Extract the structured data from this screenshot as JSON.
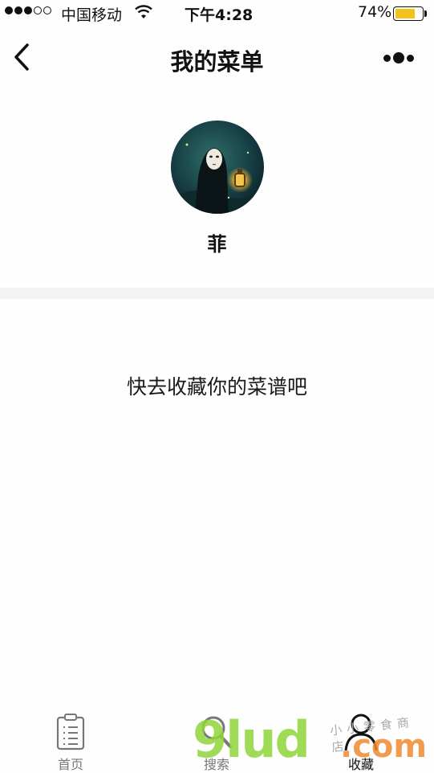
{
  "status_bar": {
    "carrier": "中国移动",
    "time": "下午4:28",
    "battery_percent": "74%",
    "battery_level": 0.74,
    "battery_color": "#f2c31a"
  },
  "nav": {
    "title": "我的菜单"
  },
  "profile": {
    "name": "菲"
  },
  "empty_state": {
    "message": "快去收藏你的菜谱吧"
  },
  "tab_bar": {
    "items": [
      {
        "label": "首页",
        "icon": "clipboard-list-icon"
      },
      {
        "label": "搜索",
        "icon": "search-icon"
      },
      {
        "label": "收藏",
        "icon": "user-icon"
      }
    ]
  },
  "watermark": {
    "logo": "9lud",
    "domain": ".com",
    "shop": "小小零食商店"
  }
}
